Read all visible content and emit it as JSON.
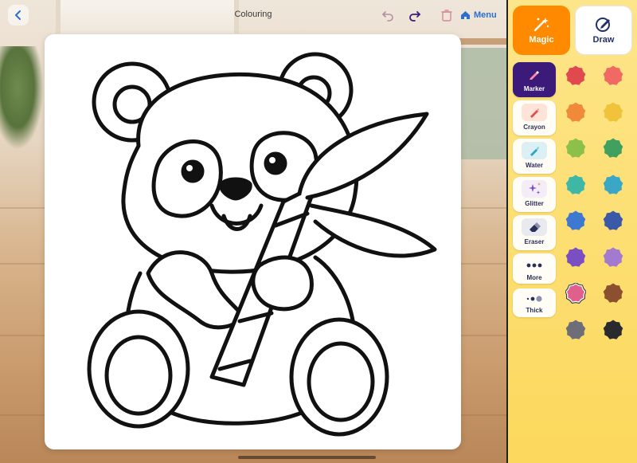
{
  "header": {
    "title": "Colouring",
    "menu_label": "Menu"
  },
  "modes": {
    "magic_label": "Magic",
    "draw_label": "Draw"
  },
  "tools": [
    {
      "label": "Marker",
      "icon": "marker-icon",
      "active": true
    },
    {
      "label": "Crayon",
      "icon": "crayon-icon",
      "active": false
    },
    {
      "label": "Water",
      "icon": "water-brush-icon",
      "active": false
    },
    {
      "label": "Glitter",
      "icon": "glitter-icon",
      "active": false
    },
    {
      "label": "Eraser",
      "icon": "eraser-icon",
      "active": false
    },
    {
      "label": "More",
      "icon": "more-dots-icon",
      "active": false
    },
    {
      "label": "Thick",
      "icon": "brush-size-icon",
      "active": false
    }
  ],
  "palette": {
    "selected": "#e0608c",
    "colors": [
      "#e04a4f",
      "#f06a63",
      "#f08a3a",
      "#f0c43a",
      "#8cc04a",
      "#3fa060",
      "#3fb7a7",
      "#3aa7c4",
      "#3f78d0",
      "#3a5aa8",
      "#7a4fc2",
      "#a27ad0",
      "#e0608c",
      "#8a5030",
      "#6e6e78",
      "#2a2a2e"
    ]
  }
}
